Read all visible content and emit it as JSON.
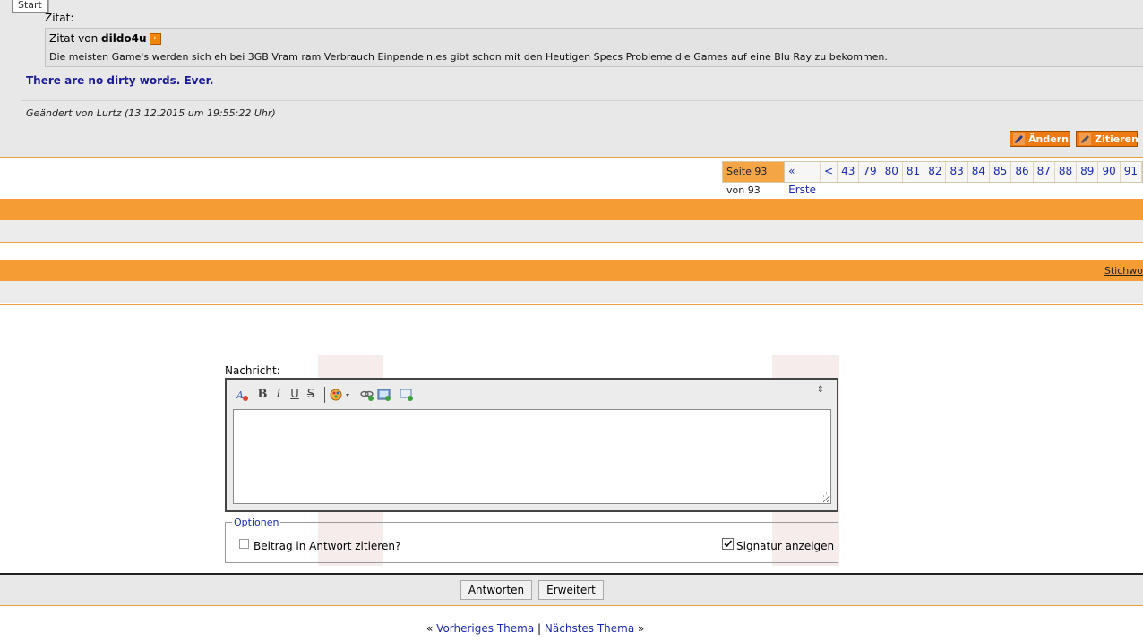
{
  "tooltip": {
    "start": "Start"
  },
  "post": {
    "quote_label": "Zitat:",
    "quote_header_prefix": "Zitat von",
    "quote_author": "dildo4u",
    "quote_text": "Die meisten Game's werden sich eh bei 3GB Vram ram Verbrauch Einpendeln,es gibt schon mit den Heutigen Specs Probleme die Games auf eine Blu Ray zu bekommen.",
    "signature": "There are no dirty words. Ever.",
    "edited_note": "Geändert von Lurtz (13.12.2015 um 19:55:22 Uhr)",
    "edit_button": "Ändern",
    "quote_button": "Zitieren"
  },
  "pagination": {
    "current": "Seite 93 von 93",
    "first": "« Erste",
    "prev": "<",
    "pages": [
      "43",
      "79",
      "80",
      "81",
      "82",
      "83",
      "84",
      "85",
      "86",
      "87",
      "88",
      "89",
      "90",
      "91"
    ]
  },
  "bands": {
    "keywords_link": "Stichwo"
  },
  "reply": {
    "message_label": "Nachricht:",
    "toolbar": {
      "remove_format": "remove-format-icon",
      "bold": "B",
      "italic": "I",
      "underline": "U",
      "strike": "S",
      "resize": "⇕"
    },
    "textarea_value": "",
    "options_legend": "Optionen",
    "quote_in_reply": "Beitrag in Antwort zitieren?",
    "quote_in_reply_checked": false,
    "show_signature": "Signatur anzeigen",
    "show_signature_checked": true,
    "submit_button": "Antworten",
    "advanced_button": "Erweitert"
  },
  "thread_nav": {
    "left_arrow": "«",
    "previous": "Vorheriges Thema",
    "separator": "|",
    "next": "Nächstes Thema",
    "right_arrow": "»"
  },
  "colors": {
    "accent_orange": "#f59d32",
    "dark_orange": "#ef7a00",
    "link_blue": "#1a2bb0",
    "signature_blue": "#1a1a9a"
  }
}
